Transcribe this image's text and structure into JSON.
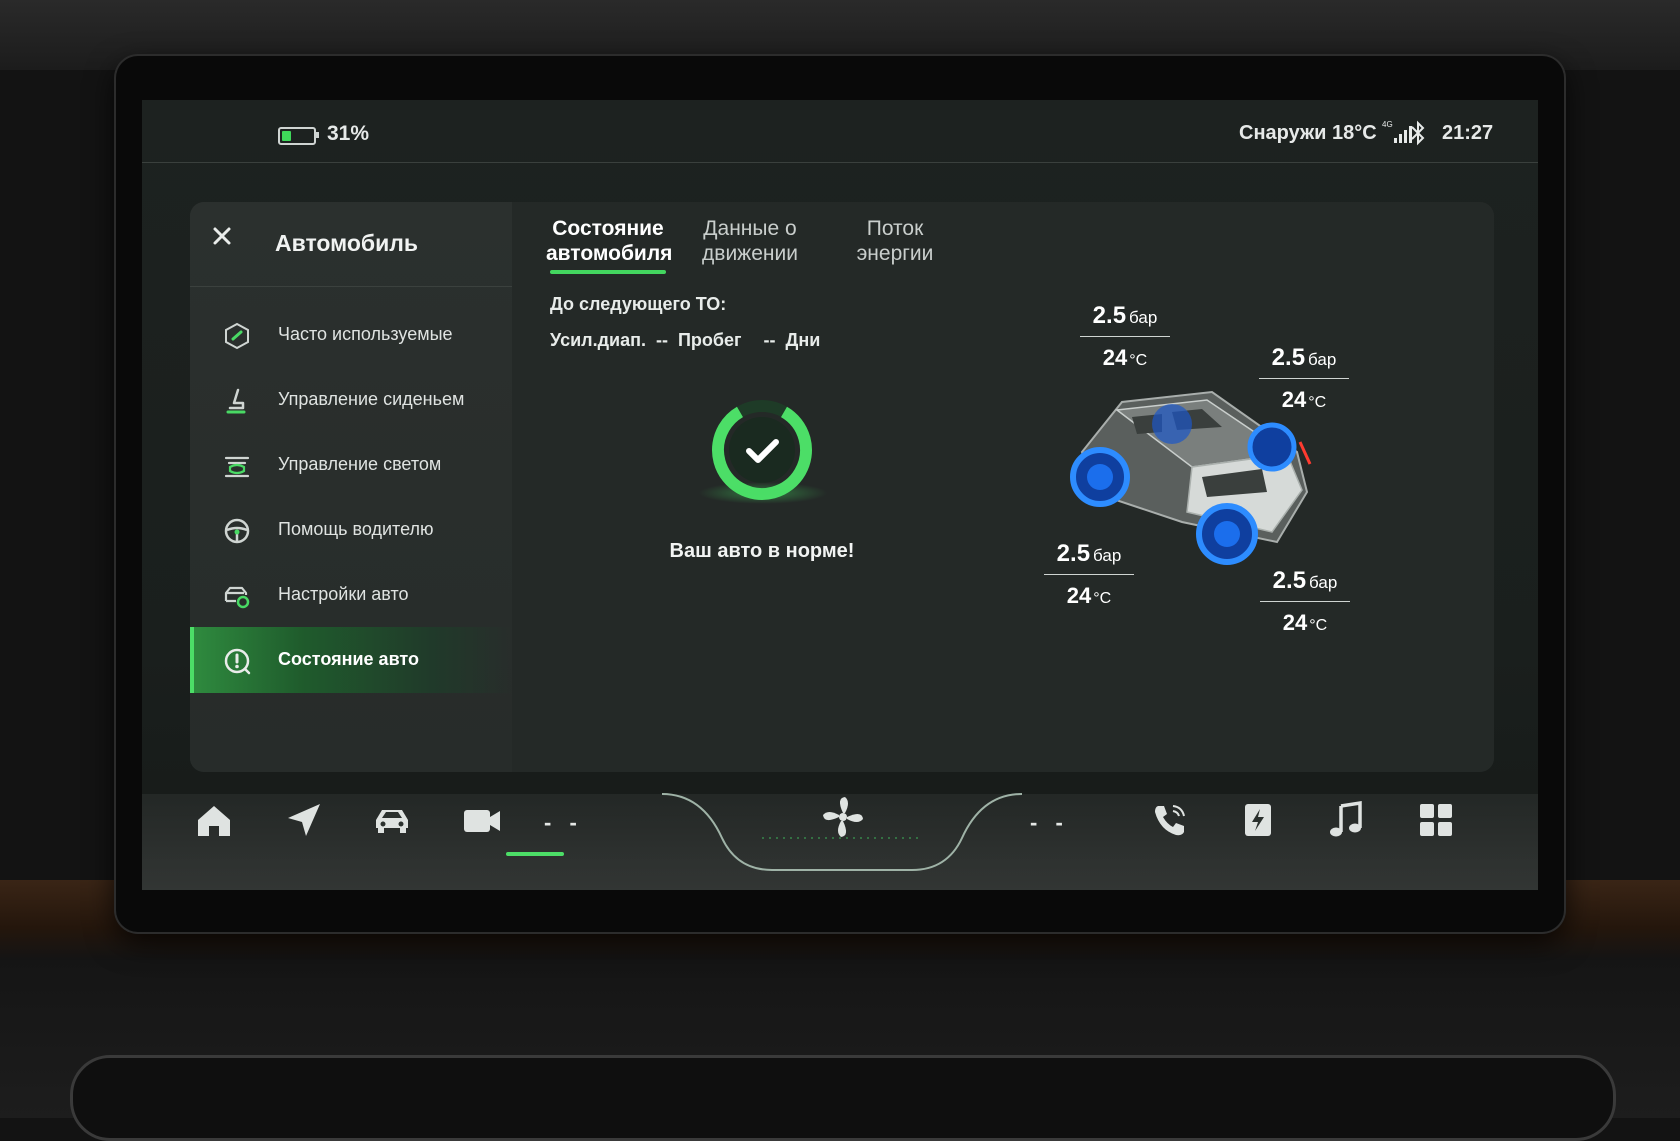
{
  "status_bar": {
    "battery_percent": "31%",
    "battery_level": 0.31,
    "outside_temp": "Снаружи 18°C",
    "network": "4G",
    "time": "21:27"
  },
  "sidebar": {
    "title": "Автомобиль",
    "items": [
      {
        "label": "Часто используемые",
        "icon": "shield-star-icon",
        "active": false
      },
      {
        "label": "Управление сиденьем",
        "icon": "seat-icon",
        "active": false
      },
      {
        "label": "Управление светом",
        "icon": "headlight-icon",
        "active": false
      },
      {
        "label": "Помощь водителю",
        "icon": "steering-wheel-icon",
        "active": false
      },
      {
        "label": "Настройки авто",
        "icon": "car-settings-icon",
        "active": false
      },
      {
        "label": "Состояние авто",
        "icon": "car-status-icon",
        "active": true
      }
    ]
  },
  "tabs": [
    {
      "line1": "Состояние",
      "line2": "автомобиля",
      "active": true
    },
    {
      "line1": "Данные о",
      "line2": "движении",
      "active": false
    },
    {
      "line1": "Поток",
      "line2": "энергии",
      "active": false
    }
  ],
  "maintenance": {
    "heading": "До следующего ТО:",
    "range_label": "Усил.диап.",
    "range_value": "--",
    "mileage_label": "Пробег",
    "days_value": "--",
    "days_label": "Дни"
  },
  "status": {
    "message": "Ваш авто в норме!"
  },
  "tires": {
    "pressure_unit": "бар",
    "temp_unit": "°C",
    "front_left": {
      "pressure": "2.5",
      "temp": "24"
    },
    "front_right": {
      "pressure": "2.5",
      "temp": "24"
    },
    "rear_left": {
      "pressure": "2.5",
      "temp": "24"
    },
    "rear_right": {
      "pressure": "2.5",
      "temp": "24"
    }
  },
  "dock": {
    "left_temp": "- -",
    "right_temp": "- -",
    "items": [
      "home-icon",
      "navigation-icon",
      "car-icon",
      "camera-icon",
      "fan-icon",
      "phone-icon",
      "charging-icon",
      "music-icon",
      "apps-icon"
    ]
  },
  "colors": {
    "accent": "#43d65f",
    "tire_glow": "#1e7bff"
  }
}
